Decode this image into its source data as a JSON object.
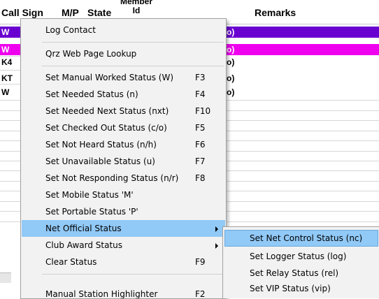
{
  "header": {
    "callsign": "Call Sign",
    "mp": "M/P",
    "state": "State",
    "member": "Member\nId",
    "remarks": "Remarks"
  },
  "rows": [
    {
      "cell": "W",
      "tail": "o)",
      "bg": "#6a00d0",
      "fg": "#ffffff"
    },
    {
      "cell": "W",
      "tail": "o)",
      "bg": "#ee00ee",
      "fg": "#ffffff"
    },
    {
      "cell": "K4",
      "tail": "o)",
      "bg": "#ffffff",
      "fg": "#000000"
    },
    {
      "cell": "KT",
      "tail": "o)",
      "bg": "#ffffff",
      "fg": "#000000"
    },
    {
      "cell": "W",
      "tail": "o)",
      "bg": "#ffffff",
      "fg": "#000000"
    }
  ],
  "menu": {
    "items": [
      {
        "label": "Log Contact",
        "shortcut": ""
      },
      {
        "label": "Qrz Web Page Lookup",
        "shortcut": ""
      },
      {
        "label": "Set Manual Worked Status (W)",
        "shortcut": "F3"
      },
      {
        "label": "Set Needed Status (n)",
        "shortcut": "F4"
      },
      {
        "label": "Set Needed Next Status (nxt)",
        "shortcut": "F10"
      },
      {
        "label": "Set Checked Out Status (c/o)",
        "shortcut": "F5"
      },
      {
        "label": "Set Not Heard Status (n/h)",
        "shortcut": "F6"
      },
      {
        "label": "Set Unavailable Status (u)",
        "shortcut": "F7"
      },
      {
        "label": "Set Not Responding Status (n/r)",
        "shortcut": "F8"
      },
      {
        "label": "Set Mobile Status 'M'",
        "shortcut": ""
      },
      {
        "label": "Set Portable Status 'P'",
        "shortcut": ""
      },
      {
        "label": "Net Official Status",
        "shortcut": ""
      },
      {
        "label": "Club Award Status",
        "shortcut": ""
      },
      {
        "label": "Clear Status",
        "shortcut": "F9"
      },
      {
        "label": "Manual Station Highlighter",
        "shortcut": "F2"
      }
    ]
  },
  "submenu": {
    "items": [
      {
        "label": "Set Net Control Status (nc)"
      },
      {
        "label": "Set Logger Status (log)"
      },
      {
        "label": "Set Relay Status (rel)"
      },
      {
        "label": "Set VIP Status (vip)"
      }
    ]
  },
  "colors": {
    "highlight": "#91c9f7",
    "menu_bg": "#f2f2f2",
    "row_purple": "#6a00d0",
    "row_magenta": "#ee00ee"
  },
  "icons": {
    "submenu_arrow": "chevron-right-icon"
  }
}
